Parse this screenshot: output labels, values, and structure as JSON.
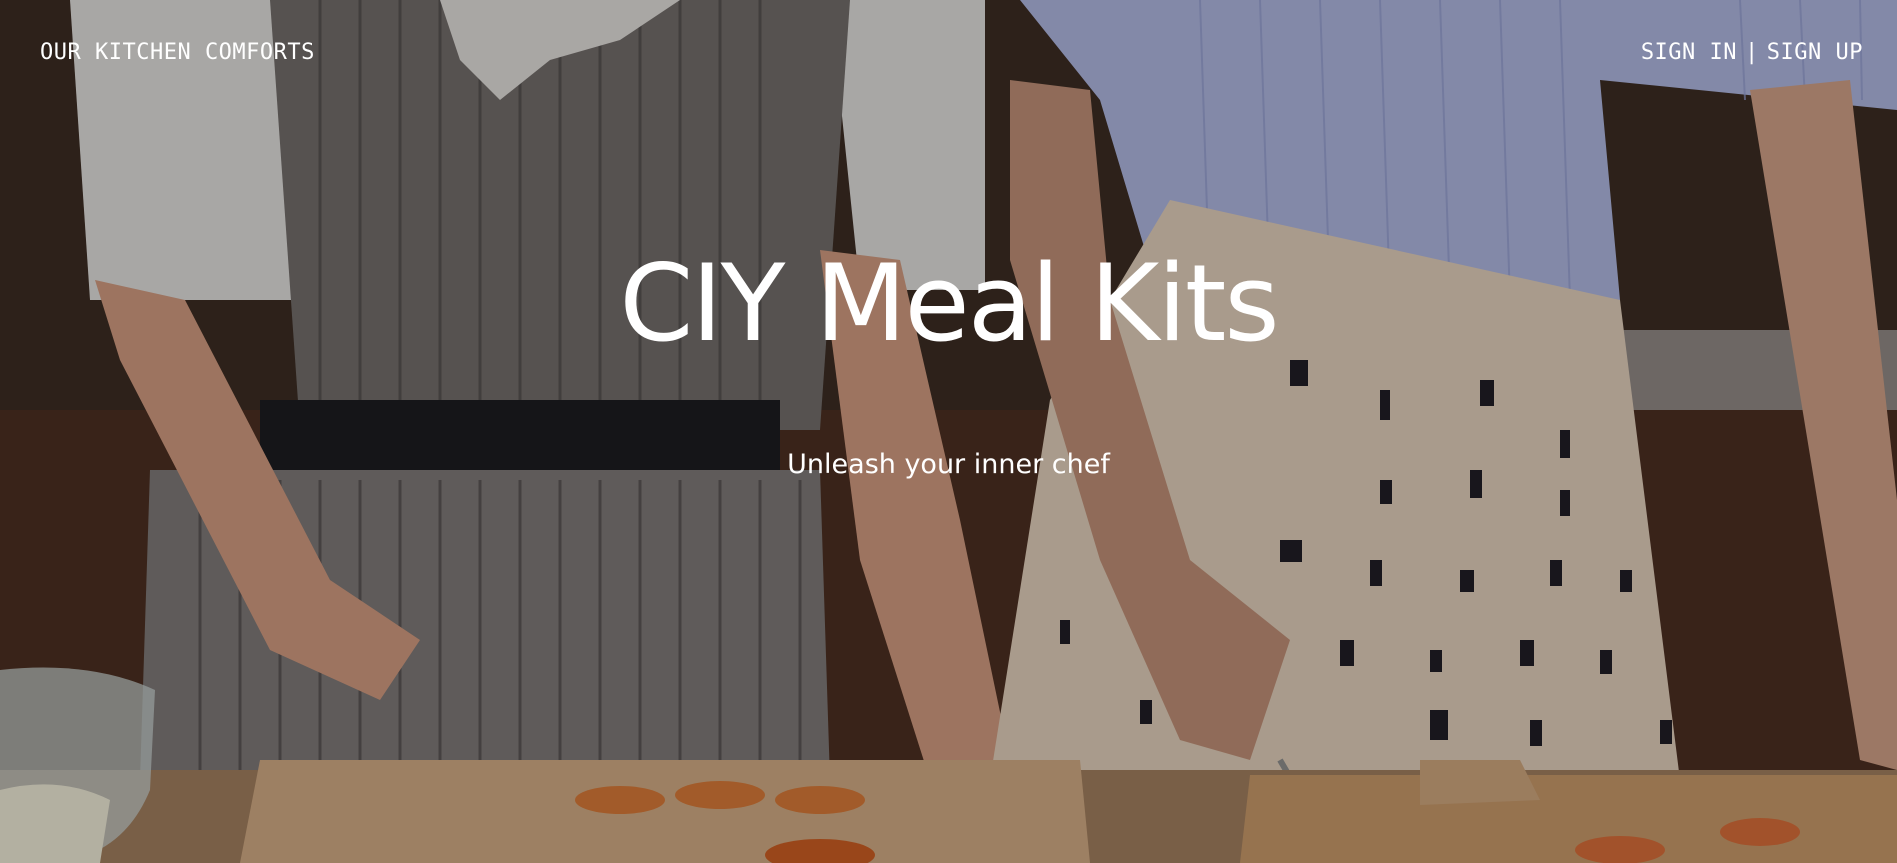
{
  "nav": {
    "brand": "OUR KITCHEN COMFORTS",
    "sign_in": "SIGN IN",
    "separator": "|",
    "sign_up": "SIGN UP"
  },
  "hero": {
    "title": "CIY Meal Kits",
    "subtitle": "Unleash your inner chef",
    "background_image": "two-people-cooking-at-kitchen-counter"
  },
  "colors": {
    "text": "#ffffff"
  }
}
